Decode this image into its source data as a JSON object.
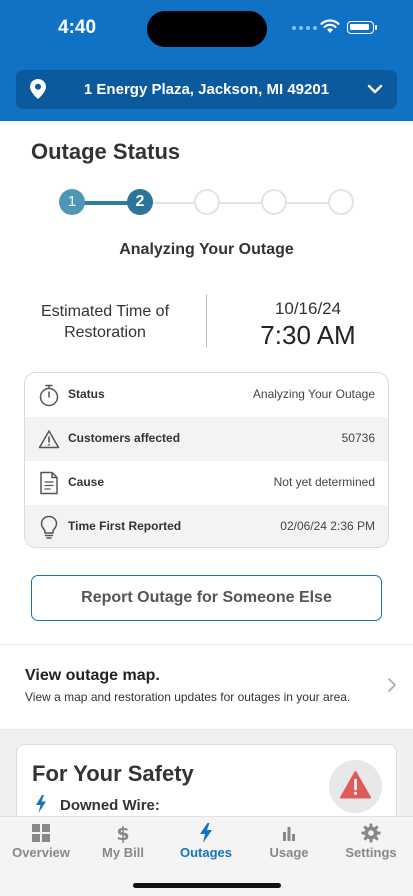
{
  "status_bar": {
    "time": "4:40"
  },
  "header": {
    "address": "1 Energy Plaza, Jackson, MI 49201",
    "location_icon": "map-pin-icon",
    "dropdown_icon": "chevron-down-icon"
  },
  "outage": {
    "title": "Outage Status",
    "steps": [
      "1",
      "2",
      "",
      "",
      ""
    ],
    "current_step": 2,
    "step_label": "Analyzing Your Outage",
    "etr_label": "Estimated Time of Restoration",
    "etr_date": "10/16/24",
    "etr_time": "7:30 AM",
    "details": [
      {
        "icon": "stopwatch-icon",
        "label": "Status",
        "value": "Analyzing Your Outage"
      },
      {
        "icon": "warning-icon",
        "label": "Customers affected",
        "value": "50736"
      },
      {
        "icon": "document-icon",
        "label": "Cause",
        "value": "Not yet determined"
      },
      {
        "icon": "lightbulb-icon",
        "label": "Time First Reported",
        "value": "02/06/24 2:36 PM"
      }
    ],
    "report_button": "Report Outage for Someone Else"
  },
  "map_link": {
    "title": "View outage map.",
    "description": "View a map and restoration updates for outages in your area."
  },
  "safety": {
    "title": "For Your Safety",
    "items": [
      "Downed Wire:"
    ]
  },
  "tabbar": {
    "tabs": [
      {
        "label": "Overview",
        "icon": "grid-icon"
      },
      {
        "label": "My Bill",
        "icon": "dollar-icon"
      },
      {
        "label": "Outages",
        "icon": "lightning-bolt-icon"
      },
      {
        "label": "Usage",
        "icon": "bar-chart-icon"
      },
      {
        "label": "Settings",
        "icon": "gear-icon"
      }
    ],
    "active": "Outages"
  },
  "colors": {
    "brand_blue": "#0f72c4",
    "address_bar": "#0c5a9e",
    "step_active": "#2c7599",
    "warning_red": "#e05a5a"
  }
}
